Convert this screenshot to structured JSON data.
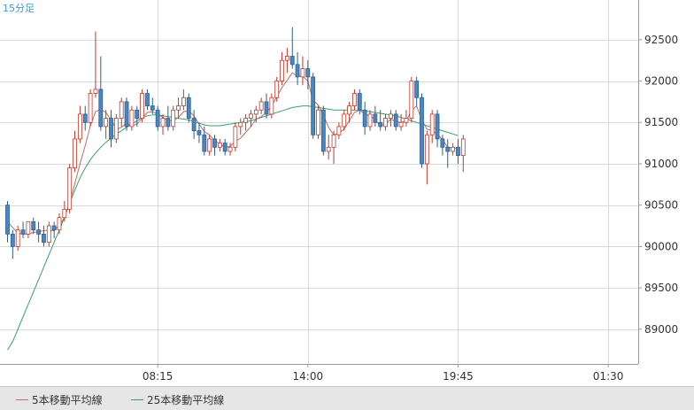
{
  "timeframe_label": "15分足",
  "legend": [
    {
      "label": "5本移動平均線",
      "color": "#c46a6a"
    },
    {
      "label": "25本移動平均線",
      "color": "#3aa06a"
    }
  ],
  "colors": {
    "up_fill": "#ffffff",
    "up_stroke": "#c0392b",
    "down_fill": "#4a87c0",
    "down_stroke": "#2c5f8f",
    "grid": "#d9d9d9",
    "tf_label": "#3a9ad9"
  },
  "chart_data": {
    "type": "candlestick",
    "ylim": [
      88580,
      92980
    ],
    "yticks": [
      89000,
      89500,
      90000,
      90500,
      91000,
      91500,
      92000,
      92500
    ],
    "ytick_labels": [
      "89000",
      "89500",
      "90000",
      "90500",
      "91000",
      "91500",
      "92000",
      "92500"
    ],
    "xticks": [
      {
        "index": 29,
        "label": "08:15"
      },
      {
        "index": 58,
        "label": "14:00"
      },
      {
        "index": 87,
        "label": "19:45"
      },
      {
        "index": 116,
        "label": "01:30"
      }
    ],
    "candles": [
      [
        90500,
        90550,
        90050,
        90150
      ],
      [
        90150,
        90200,
        89850,
        90000
      ],
      [
        90000,
        90250,
        89950,
        90200
      ],
      [
        90200,
        90300,
        90100,
        90150
      ],
      [
        90150,
        90300,
        90100,
        90300
      ],
      [
        90300,
        90350,
        90150,
        90200
      ],
      [
        90200,
        90300,
        90050,
        90150
      ],
      [
        90150,
        90250,
        90000,
        90050
      ],
      [
        90050,
        90300,
        90000,
        90250
      ],
      [
        90250,
        90300,
        90100,
        90200
      ],
      [
        90200,
        90400,
        90150,
        90350
      ],
      [
        90350,
        90550,
        90300,
        90450
      ],
      [
        90450,
        91000,
        90400,
        90950
      ],
      [
        90950,
        91400,
        90900,
        91300
      ],
      [
        91300,
        91700,
        91250,
        91600
      ],
      [
        91600,
        91700,
        91400,
        91500
      ],
      [
        91500,
        91900,
        91450,
        91850
      ],
      [
        91850,
        92600,
        91800,
        91900
      ],
      [
        91900,
        92300,
        91400,
        91450
      ],
      [
        91450,
        91650,
        91300,
        91550
      ],
      [
        91550,
        91650,
        91200,
        91300
      ],
      [
        91300,
        91600,
        91250,
        91550
      ],
      [
        91550,
        91800,
        91450,
        91750
      ],
      [
        91750,
        91800,
        91400,
        91450
      ],
      [
        91450,
        91700,
        91400,
        91650
      ],
      [
        91650,
        91700,
        91450,
        91550
      ],
      [
        91550,
        91900,
        91500,
        91850
      ],
      [
        91850,
        91900,
        91650,
        91700
      ],
      [
        91700,
        91800,
        91600,
        91650
      ],
      [
        91650,
        91700,
        91400,
        91450
      ],
      [
        91450,
        91600,
        91350,
        91550
      ],
      [
        91550,
        91700,
        91400,
        91450
      ],
      [
        91450,
        91700,
        91400,
        91650
      ],
      [
        91650,
        91800,
        91550,
        91700
      ],
      [
        91700,
        91900,
        91650,
        91800
      ],
      [
        91800,
        91850,
        91500,
        91550
      ],
      [
        91550,
        91650,
        91300,
        91400
      ],
      [
        91400,
        91500,
        91250,
        91350
      ],
      [
        91350,
        91450,
        91100,
        91150
      ],
      [
        91150,
        91350,
        91100,
        91300
      ],
      [
        91300,
        91350,
        91100,
        91200
      ],
      [
        91200,
        91300,
        91150,
        91250
      ],
      [
        91250,
        91300,
        91100,
        91150
      ],
      [
        91150,
        91250,
        91100,
        91200
      ],
      [
        91200,
        91500,
        91150,
        91450
      ],
      [
        91450,
        91550,
        91350,
        91500
      ],
      [
        91500,
        91600,
        91400,
        91550
      ],
      [
        91550,
        91650,
        91450,
        91600
      ],
      [
        91600,
        91700,
        91500,
        91650
      ],
      [
        91650,
        91800,
        91600,
        91750
      ],
      [
        91750,
        91850,
        91550,
        91600
      ],
      [
        91600,
        91850,
        91550,
        91800
      ],
      [
        91800,
        92050,
        91750,
        92000
      ],
      [
        92000,
        92350,
        91950,
        92250
      ],
      [
        92250,
        92400,
        92100,
        92300
      ],
      [
        92300,
        92650,
        92150,
        92200
      ],
      [
        92200,
        92350,
        91950,
        92050
      ],
      [
        92050,
        92300,
        91950,
        92150
      ],
      [
        92150,
        92250,
        91900,
        92050
      ],
      [
        92050,
        92100,
        91300,
        91350
      ],
      [
        91350,
        91700,
        91300,
        91650
      ],
      [
        91650,
        91700,
        91100,
        91150
      ],
      [
        91150,
        91350,
        91050,
        91200
      ],
      [
        91200,
        91400,
        91000,
        91350
      ],
      [
        91350,
        91500,
        91300,
        91450
      ],
      [
        91450,
        91650,
        91400,
        91600
      ],
      [
        91600,
        91750,
        91500,
        91700
      ],
      [
        91700,
        91900,
        91650,
        91850
      ],
      [
        91850,
        91900,
        91600,
        91650
      ],
      [
        91650,
        91750,
        91350,
        91450
      ],
      [
        91450,
        91650,
        91400,
        91600
      ],
      [
        91600,
        91700,
        91450,
        91500
      ],
      [
        91500,
        91650,
        91400,
        91450
      ],
      [
        91450,
        91600,
        91400,
        91550
      ],
      [
        91550,
        91650,
        91450,
        91600
      ],
      [
        91600,
        91650,
        91400,
        91450
      ],
      [
        91450,
        91600,
        91400,
        91500
      ],
      [
        91500,
        91650,
        91450,
        91550
      ],
      [
        91550,
        92050,
        91500,
        92000
      ],
      [
        92000,
        92050,
        91700,
        91800
      ],
      [
        91800,
        91850,
        90950,
        91000
      ],
      [
        91000,
        91400,
        90750,
        91350
      ],
      [
        91350,
        91650,
        91250,
        91600
      ],
      [
        91600,
        91650,
        91200,
        91300
      ],
      [
        91300,
        91350,
        91100,
        91200
      ],
      [
        91200,
        91300,
        90950,
        91150
      ],
      [
        91150,
        91250,
        91100,
        91200
      ],
      [
        91200,
        91300,
        91000,
        91100
      ],
      [
        91100,
        91350,
        90900,
        91300
      ]
    ],
    "ma5": [
      90300,
      90230,
      90160,
      90150,
      90150,
      90170,
      90180,
      90190,
      90200,
      90190,
      90260,
      90350,
      90530,
      90760,
      91000,
      91220,
      91460,
      91630,
      91660,
      91620,
      91530,
      91420,
      91440,
      91490,
      91460,
      91480,
      91550,
      91620,
      91630,
      91600,
      91560,
      91520,
      91520,
      91560,
      91630,
      91640,
      91580,
      91480,
      91390,
      91350,
      91280,
      91240,
      91200,
      91210,
      91270,
      91310,
      91380,
      91450,
      91540,
      91570,
      91620,
      91700,
      91810,
      91920,
      92010,
      92100,
      92060,
      92060,
      92000,
      91770,
      91710,
      91590,
      91440,
      91350,
      91370,
      91420,
      91520,
      91620,
      91650,
      91600,
      91580,
      91530,
      91460,
      91480,
      91540,
      91510,
      91500,
      91520,
      91640,
      91700,
      91530,
      91420,
      91400,
      91360,
      91290,
      91200,
      91190,
      91180
    ],
    "ma25": [
      88750,
      88850,
      89000,
      89150,
      89300,
      89450,
      89600,
      89750,
      89900,
      90050,
      90200,
      90350,
      90520,
      90680,
      90830,
      90950,
      91050,
      91130,
      91200,
      91260,
      91310,
      91360,
      91400,
      91440,
      91480,
      91520,
      91560,
      91580,
      91590,
      91590,
      91580,
      91570,
      91560,
      91550,
      91540,
      91530,
      91510,
      91490,
      91470,
      91460,
      91460,
      91460,
      91470,
      91480,
      91490,
      91500,
      91510,
      91520,
      91540,
      91560,
      91580,
      91600,
      91620,
      91640,
      91660,
      91680,
      91690,
      91700,
      91700,
      91690,
      91680,
      91670,
      91660,
      91650,
      91650,
      91650,
      91650,
      91650,
      91650,
      91640,
      91630,
      91620,
      91610,
      91600,
      91590,
      91580,
      91560,
      91540,
      91520,
      91500,
      91480,
      91460,
      91440,
      91420,
      91400,
      91380,
      91360,
      91340
    ]
  }
}
